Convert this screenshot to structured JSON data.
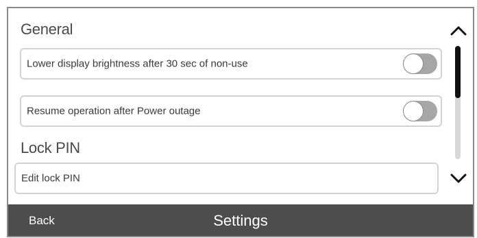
{
  "sections": {
    "general": {
      "title": "General",
      "items": [
        {
          "label": "Lower display brightness after 30 sec of non-use",
          "toggle_on": false
        },
        {
          "label": "Resume operation after Power outage",
          "toggle_on": false
        }
      ]
    },
    "lock_pin": {
      "title": "Lock PIN",
      "items": [
        {
          "label": "Edit lock PIN"
        }
      ]
    }
  },
  "scroll": {
    "up_icon": "chevron-up-icon",
    "down_icon": "chevron-down-icon",
    "position_fraction": 0.0
  },
  "footer": {
    "back_label": "Back",
    "title": "Settings"
  },
  "colors": {
    "footer_bg": "#4d4d4d",
    "toggle_off": "#a6a6a6",
    "row_border": "#d3d3d3",
    "scroll_thumb": "#111111"
  }
}
